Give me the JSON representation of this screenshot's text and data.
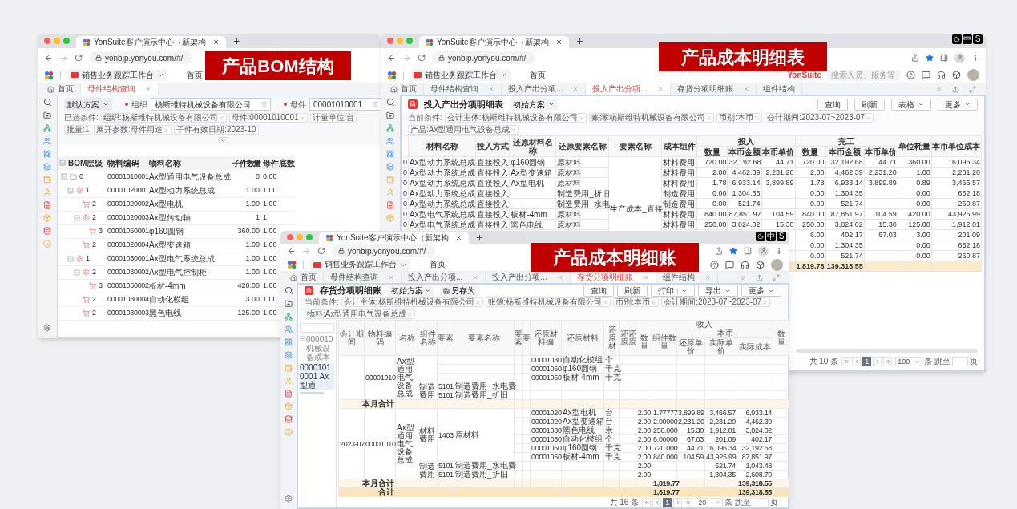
{
  "banners": [
    {
      "text": "产品BOM结构"
    },
    {
      "text": "产品成本明细表"
    },
    {
      "text": "产品成本明细账"
    }
  ],
  "bom_window": {
    "browser_tab": "YonSuite客户演示中心（新架构",
    "url": "yonbip.yonyou.com/#/",
    "workspace": "销售业务跟踪工作台",
    "home_nav": "首页",
    "tabs": [
      {
        "label": "首页",
        "kind": "home",
        "selected": false,
        "closable": false
      },
      {
        "label": "母件结构查询",
        "kind": "page",
        "selected": true,
        "closable": true
      }
    ],
    "scheme": "默认方案",
    "filters": [
      {
        "label": "组织",
        "required": true,
        "value": "杨斯维特机械设备有限公司"
      },
      {
        "label": "母件",
        "required": true,
        "value": "00001010001"
      }
    ],
    "conditions_label": "已选条件:",
    "filter_toggle": {
      "expanded": false
    },
    "chips": [
      {
        "text": "组织:杨斯维特机械设备有限公司",
        "removable": true
      },
      {
        "text": "母件:00001010001",
        "removable": true
      },
      {
        "text": "计量单位:台",
        "removable": false
      },
      {
        "text": "批量:1",
        "removable": false
      },
      {
        "text": "展开参数:母件用途",
        "removable": true
      },
      {
        "text": "子件有效日期:2023-10",
        "removable": false
      }
    ],
    "table": {
      "columns": [
        "BOM层级",
        "物料编码",
        "物料名称",
        "子件数量",
        "母件底数"
      ],
      "rows": [
        {
          "kind": "folder",
          "level": "0",
          "code": "00001010001",
          "name": "Ax型通用电气设备总成",
          "qty": "0",
          "base": "0.00",
          "expanded": true,
          "children": [
            {
              "kind": "assembly",
              "level": "1",
              "code": "00001020001",
              "name": "Ax型动力系统总成",
              "qty": "1.00",
              "base": "1.00",
              "expanded": true,
              "children": [
                {
                  "kind": "part",
                  "level": "2",
                  "code": "00001020002",
                  "name": "Ax型电机",
                  "qty": "1.00",
                  "base": "1.00"
                },
                {
                  "kind": "assembly",
                  "level": "2",
                  "code": "00001020003",
                  "name": "Ax型传动轴",
                  "qty": "1",
                  "base": "1",
                  "expanded": true,
                  "children": [
                    {
                      "kind": "part",
                      "level": "3",
                      "code": "00001050001",
                      "name": "φ160圆钢",
                      "qty": "360.00",
                      "base": "1.00"
                    }
                  ]
                },
                {
                  "kind": "part",
                  "level": "2",
                  "code": "00001020004",
                  "name": "Ax型变速箱",
                  "qty": "1.00",
                  "base": "1.00"
                }
              ]
            },
            {
              "kind": "assembly",
              "level": "1",
              "code": "00001030001",
              "name": "Ax型电气系统总成",
              "qty": "1.00",
              "base": "1.00",
              "expanded": true,
              "children": [
                {
                  "kind": "assembly",
                  "level": "2",
                  "code": "00001030002",
                  "name": "Ax型电气控制柜",
                  "qty": "1.00",
                  "base": "1.00",
                  "expanded": true,
                  "children": [
                    {
                      "kind": "part",
                      "level": "3",
                      "code": "00001050002",
                      "name": "板材-4mm",
                      "qty": "420.00",
                      "base": "1.00"
                    }
                  ]
                },
                {
                  "kind": "part",
                  "level": "2",
                  "code": "00001030004",
                  "name": "自动化模组",
                  "qty": "3.00",
                  "base": "1.00"
                },
                {
                  "kind": "part",
                  "level": "2",
                  "code": "00001030003",
                  "name": "黑色电线",
                  "qty": "125.00",
                  "base": "1.00"
                }
              ]
            }
          ]
        }
      ]
    }
  },
  "cost_window": {
    "browser_tab": "YonSuite客户演示中心（新架构",
    "ime": [
      "中",
      "S"
    ],
    "url": "yonbip.yonyou.com/#/",
    "workspace": "销售业务跟踪工作台",
    "home_nav": "首页",
    "brand": "YonSuite",
    "search_placeholder": "搜索人员、服务等",
    "tabs": [
      {
        "label": "首页",
        "kind": "home",
        "selected": false,
        "closable": false
      },
      {
        "label": "母件结构查询",
        "kind": "page",
        "selected": false,
        "closable": true
      },
      {
        "label": "投入产出分项...",
        "kind": "page",
        "selected": false,
        "closable": true
      },
      {
        "label": "投入产出分项...",
        "kind": "page",
        "selected": true,
        "closable": true
      },
      {
        "label": "存货分项明细账",
        "kind": "page",
        "selected": false,
        "closable": true
      },
      {
        "label": "组件结构",
        "kind": "page",
        "selected": false,
        "closable": false
      }
    ],
    "title": "投入产出分项明细表",
    "scheme": "初始方案",
    "actions": [
      {
        "label": "查询",
        "kind": "plain"
      },
      {
        "label": "刷新",
        "kind": "plain"
      },
      {
        "label": "表格",
        "kind": "menu"
      },
      {
        "label": "更多",
        "kind": "menu"
      }
    ],
    "conditions_label": "当前条件:",
    "chips": [
      {
        "text": "会计主体:杨斯维特机械设备有限公司",
        "removable": true
      },
      {
        "text": "账簿:杨斯维特机械设备有限公司",
        "removable": true
      },
      {
        "text": "币别:本币",
        "removable": true
      },
      {
        "text": "会计期间:2023-07~2023-07",
        "removable": true
      },
      {
        "text": "产品:Ax型通用电气设备总成",
        "removable": true
      }
    ],
    "table": {
      "columns": [
        "材料名称",
        "投入方式",
        "还原材料名称",
        "还原要素名称",
        "要素名称",
        "成本组件"
      ],
      "groups": [
        {
          "label": "投入",
          "columns": [
            "数量",
            "本币金额",
            "本币单价"
          ]
        },
        {
          "label": "完工",
          "columns": [
            "数量",
            "本币金额",
            "本币单价"
          ]
        }
      ],
      "tail_columns": [
        "单位耗量",
        "本币单位成本"
      ],
      "merged_element": "生产成本_直接",
      "rows": [
        {
          "column_1": "0",
          "material": "Ax型动力系统总成",
          "method": "直接投入",
          "restore_material": "φ160圆钢",
          "restore_element": "原材料",
          "component": "材料费用",
          "in_qty": "720.00",
          "in_amount": "32,192.68",
          "in_price": "44.71",
          "out_qty": "720.00",
          "out_amount": "32,192.68",
          "out_price": "44.71",
          "unit_use": "360.00",
          "unit_cost": "16,096.34"
        },
        {
          "column_1": "0",
          "material": "Ax型动力系统总成",
          "method": "直接投入",
          "restore_material": "Ax型变速箱",
          "restore_element": "原材料",
          "component": "材料费用",
          "in_qty": "2.00",
          "in_amount": "4,462.39",
          "in_price": "2,231.20",
          "out_qty": "2.00",
          "out_amount": "4,462.39",
          "out_price": "2,231.20",
          "unit_use": "1.00",
          "unit_cost": "2,231.20"
        },
        {
          "column_1": "0",
          "material": "Ax型动力系统总成",
          "method": "直接投入",
          "restore_material": "Ax型电机",
          "restore_element": "原材料",
          "component": "材料费用",
          "in_qty": "1.78",
          "in_amount": "6,933.14",
          "in_price": "3,899.89",
          "out_qty": "1.78",
          "out_amount": "6,933.14",
          "out_price": "3,899.89",
          "unit_use": "0.89",
          "unit_cost": "3,466.57"
        },
        {
          "column_1": "0",
          "material": "Ax型动力系统总成",
          "method": "直接投入",
          "restore_element": "制造费用_折旧",
          "component": "制造费用",
          "in_qty": "0.00",
          "in_amount": "1,304.35",
          "out_qty": "0.00",
          "out_amount": "1,304.35",
          "unit_use": "0.00",
          "unit_cost": "652.18"
        },
        {
          "column_1": "0",
          "material": "Ax型动力系统总成",
          "method": "直接投入",
          "restore_element": "制造费用_水电",
          "component": "制造费用",
          "in_qty": "0.00",
          "in_amount": "521.74",
          "out_qty": "0.00",
          "out_amount": "521.74",
          "unit_use": "0.00",
          "unit_cost": "260.87"
        },
        {
          "column_1": "0",
          "material": "Ax型电气系统总成",
          "method": "直接投入",
          "restore_material": "板材-4mm",
          "restore_element": "原材料",
          "component": "材料费用",
          "in_qty": "840.00",
          "in_amount": "87,851.97",
          "in_price": "104.59",
          "out_qty": "840.00",
          "out_amount": "87,851.97",
          "out_price": "104.59",
          "unit_use": "420.00",
          "unit_cost": "43,925.99"
        },
        {
          "column_1": "0",
          "material": "Ax型电气系统总成",
          "method": "直接投入",
          "restore_material": "黑色电线",
          "restore_element": "原材料",
          "component": "材料费用",
          "in_qty": "250.00",
          "in_amount": "3,824.02",
          "in_price": "15.30",
          "out_qty": "250.00",
          "out_amount": "3,824.02",
          "out_price": "15.30",
          "unit_use": "125.00",
          "unit_cost": "1,912.01"
        },
        {
          "out_qty": "6.00",
          "out_amount": "402.17",
          "out_price": "67.03",
          "unit_use": "3.00",
          "unit_cost": "201.09"
        },
        {
          "out_qty": "0.00",
          "out_amount": "1,304.35",
          "unit_use": "0.00",
          "unit_cost": "652.18"
        },
        {
          "out_qty": "0.00",
          "out_amount": "521.74",
          "unit_use": "0.00",
          "unit_cost": "260.87"
        }
      ],
      "total": {
        "out_qty": "1,819.78",
        "out_amount": "139,318.55"
      }
    },
    "pagination": {
      "total": "共 10 条",
      "page": "1",
      "page_size": "100",
      "jump_label": "条 跳至",
      "page_suffix": "页"
    }
  },
  "ledger_window": {
    "browser_tab": "YonSuite客户演示中心（新架构",
    "ime": [
      "中",
      "S"
    ],
    "url": "yonbip.yonyou.com/#/",
    "workspace": "销售业务跟踪工作台",
    "home_nav": "首页",
    "tabs": [
      {
        "label": "首页",
        "kind": "home",
        "selected": false,
        "closable": false
      },
      {
        "label": "母件结构查询",
        "kind": "page",
        "selected": false,
        "closable": true
      },
      {
        "label": "投入产出分项...",
        "kind": "page",
        "selected": false,
        "closable": true
      },
      {
        "label": "投入产出分项...",
        "kind": "page",
        "selected": false,
        "closable": true
      },
      {
        "label": "存货分项明细账",
        "kind": "page",
        "selected": true,
        "closable": true
      },
      {
        "label": "组件结构",
        "kind": "page",
        "selected": false,
        "closable": true
      }
    ],
    "title": "存货分项明细账",
    "scheme": "初始方案",
    "save_as": "另存为",
    "actions": [
      {
        "label": "查询",
        "kind": "plain"
      },
      {
        "label": "刷新",
        "kind": "plain"
      },
      {
        "label": "打印",
        "kind": "split"
      },
      {
        "label": "导出",
        "kind": "menu"
      },
      {
        "label": "更多",
        "kind": "menu"
      }
    ],
    "conditions_label": "当前条件:",
    "chips": [
      {
        "text": "会计主体:杨斯维特机械设备有限公司",
        "removable": true
      },
      {
        "text": "账簿:杨斯维特机械设备有限公司",
        "removable": true
      },
      {
        "text": "币别:本币",
        "removable": true
      },
      {
        "text": "会计期间:2023-07~2023-07",
        "removable": true
      },
      {
        "text": "物料:Ax型通用电气设备总成",
        "removable": true
      }
    ],
    "tree": [
      {
        "label": "000010 机械设备成本",
        "selected": false,
        "expanded": true,
        "children": [
          {
            "label": "00001010001 Ax型通",
            "selected": true
          }
        ]
      }
    ],
    "table": {
      "columns": [
        "会计期间",
        "物料编码",
        "名称",
        "组件名称",
        "要素",
        "要素名称",
        "要素",
        "要",
        "还原材料编",
        "还原材料",
        "还原材",
        "还原",
        "还原"
      ],
      "income_group": "收入",
      "income_columns": [
        "数量",
        "组件数量"
      ],
      "currency_group": "本币",
      "currency_columns": [
        "还原单价",
        "实际单价",
        "实际成本"
      ],
      "last_column": "数量",
      "groups": [
        {
          "code": "00001010",
          "name": "Ax型通用电气设备总成",
          "components": [
            {
              "lines": [
                {
                  "material_code": "00001030",
                  "material": "自动化模组",
                  "unit": "个"
                },
                {
                  "material_code": "00001050",
                  "material": "φ160圆钢",
                  "unit": "千克"
                },
                {
                  "material_code": "00001050",
                  "material": "板材-4mm",
                  "unit": "千克"
                }
              ]
            },
            {
              "name": "制造费用",
              "lines": [
                {
                  "element_code": "5101",
                  "element_name": "制造费用_水电费"
                },
                {
                  "element_code": "5101",
                  "element_name": "制造费用_折旧"
                }
              ]
            }
          ],
          "subtotal": {
            "label": "本月合计"
          }
        },
        {
          "period": "2023-07",
          "code": "00001010",
          "name": "Ax型通用电气设备总成",
          "components": [
            {
              "name": "材料费用",
              "element_code": "1403",
              "element_name": "原材料",
              "lines": [
                {
                  "material_code": "00001020",
                  "material": "Ax型电机",
                  "unit": "台",
                  "qty": "2.00",
                  "comp_qty": "1.77777",
                  "restore_price": "3,899.89",
                  "actual_price": "3,466.57",
                  "actual_cost": "6,933.14"
                },
                {
                  "material_code": "00001020",
                  "material": "Ax型变速箱",
                  "unit": "台",
                  "qty": "2.00",
                  "comp_qty": "2.00000",
                  "restore_price": "2,231.20",
                  "actual_price": "2,231.20",
                  "actual_cost": "4,462.39"
                },
                {
                  "material_code": "00001030",
                  "material": "黑色电线",
                  "unit": "米",
                  "qty": "2.00",
                  "comp_qty": "250.000",
                  "restore_price": "15.30",
                  "actual_price": "1,912.01",
                  "actual_cost": "3,824.02"
                },
                {
                  "material_code": "00001030",
                  "material": "自动化模组",
                  "unit": "个",
                  "qty": "2.00",
                  "comp_qty": "6.00000",
                  "restore_price": "67.03",
                  "actual_price": "201.09",
                  "actual_cost": "402.17"
                },
                {
                  "material_code": "00001050",
                  "material": "φ160圆钢",
                  "unit": "千克",
                  "qty": "2.00",
                  "comp_qty": "720.000",
                  "restore_price": "44.71",
                  "actual_price": "16,096.34",
                  "actual_cost": "32,192.68"
                },
                {
                  "material_code": "00001050",
                  "material": "板材-4mm",
                  "unit": "千克",
                  "qty": "2.00",
                  "comp_qty": "840.000",
                  "restore_price": "104.59",
                  "actual_price": "43,925.99",
                  "actual_cost": "87,851.97"
                }
              ]
            },
            {
              "name": "制造费用",
              "lines": [
                {
                  "element_code": "5101",
                  "element_name": "制造费用_水电费",
                  "qty": "2.00",
                  "actual_price": "521.74",
                  "actual_cost": "1,043.48"
                },
                {
                  "element_code": "5101",
                  "element_name": "制造费用_折旧",
                  "qty": "2.00",
                  "actual_price": "1,304.35",
                  "actual_cost": "2,608.70"
                }
              ]
            }
          ],
          "subtotal": {
            "label": "本月合计",
            "comp_qty": "1,819.77",
            "actual_cost": "139,318.55"
          }
        }
      ],
      "total": {
        "label": "合计",
        "comp_qty": "1,819.77",
        "actual_cost": "139,318.55"
      }
    },
    "pagination": {
      "total": "共 16 条",
      "page": "1",
      "page_size": "20",
      "jump_label": "条 跳至",
      "page_suffix": "页"
    }
  }
}
